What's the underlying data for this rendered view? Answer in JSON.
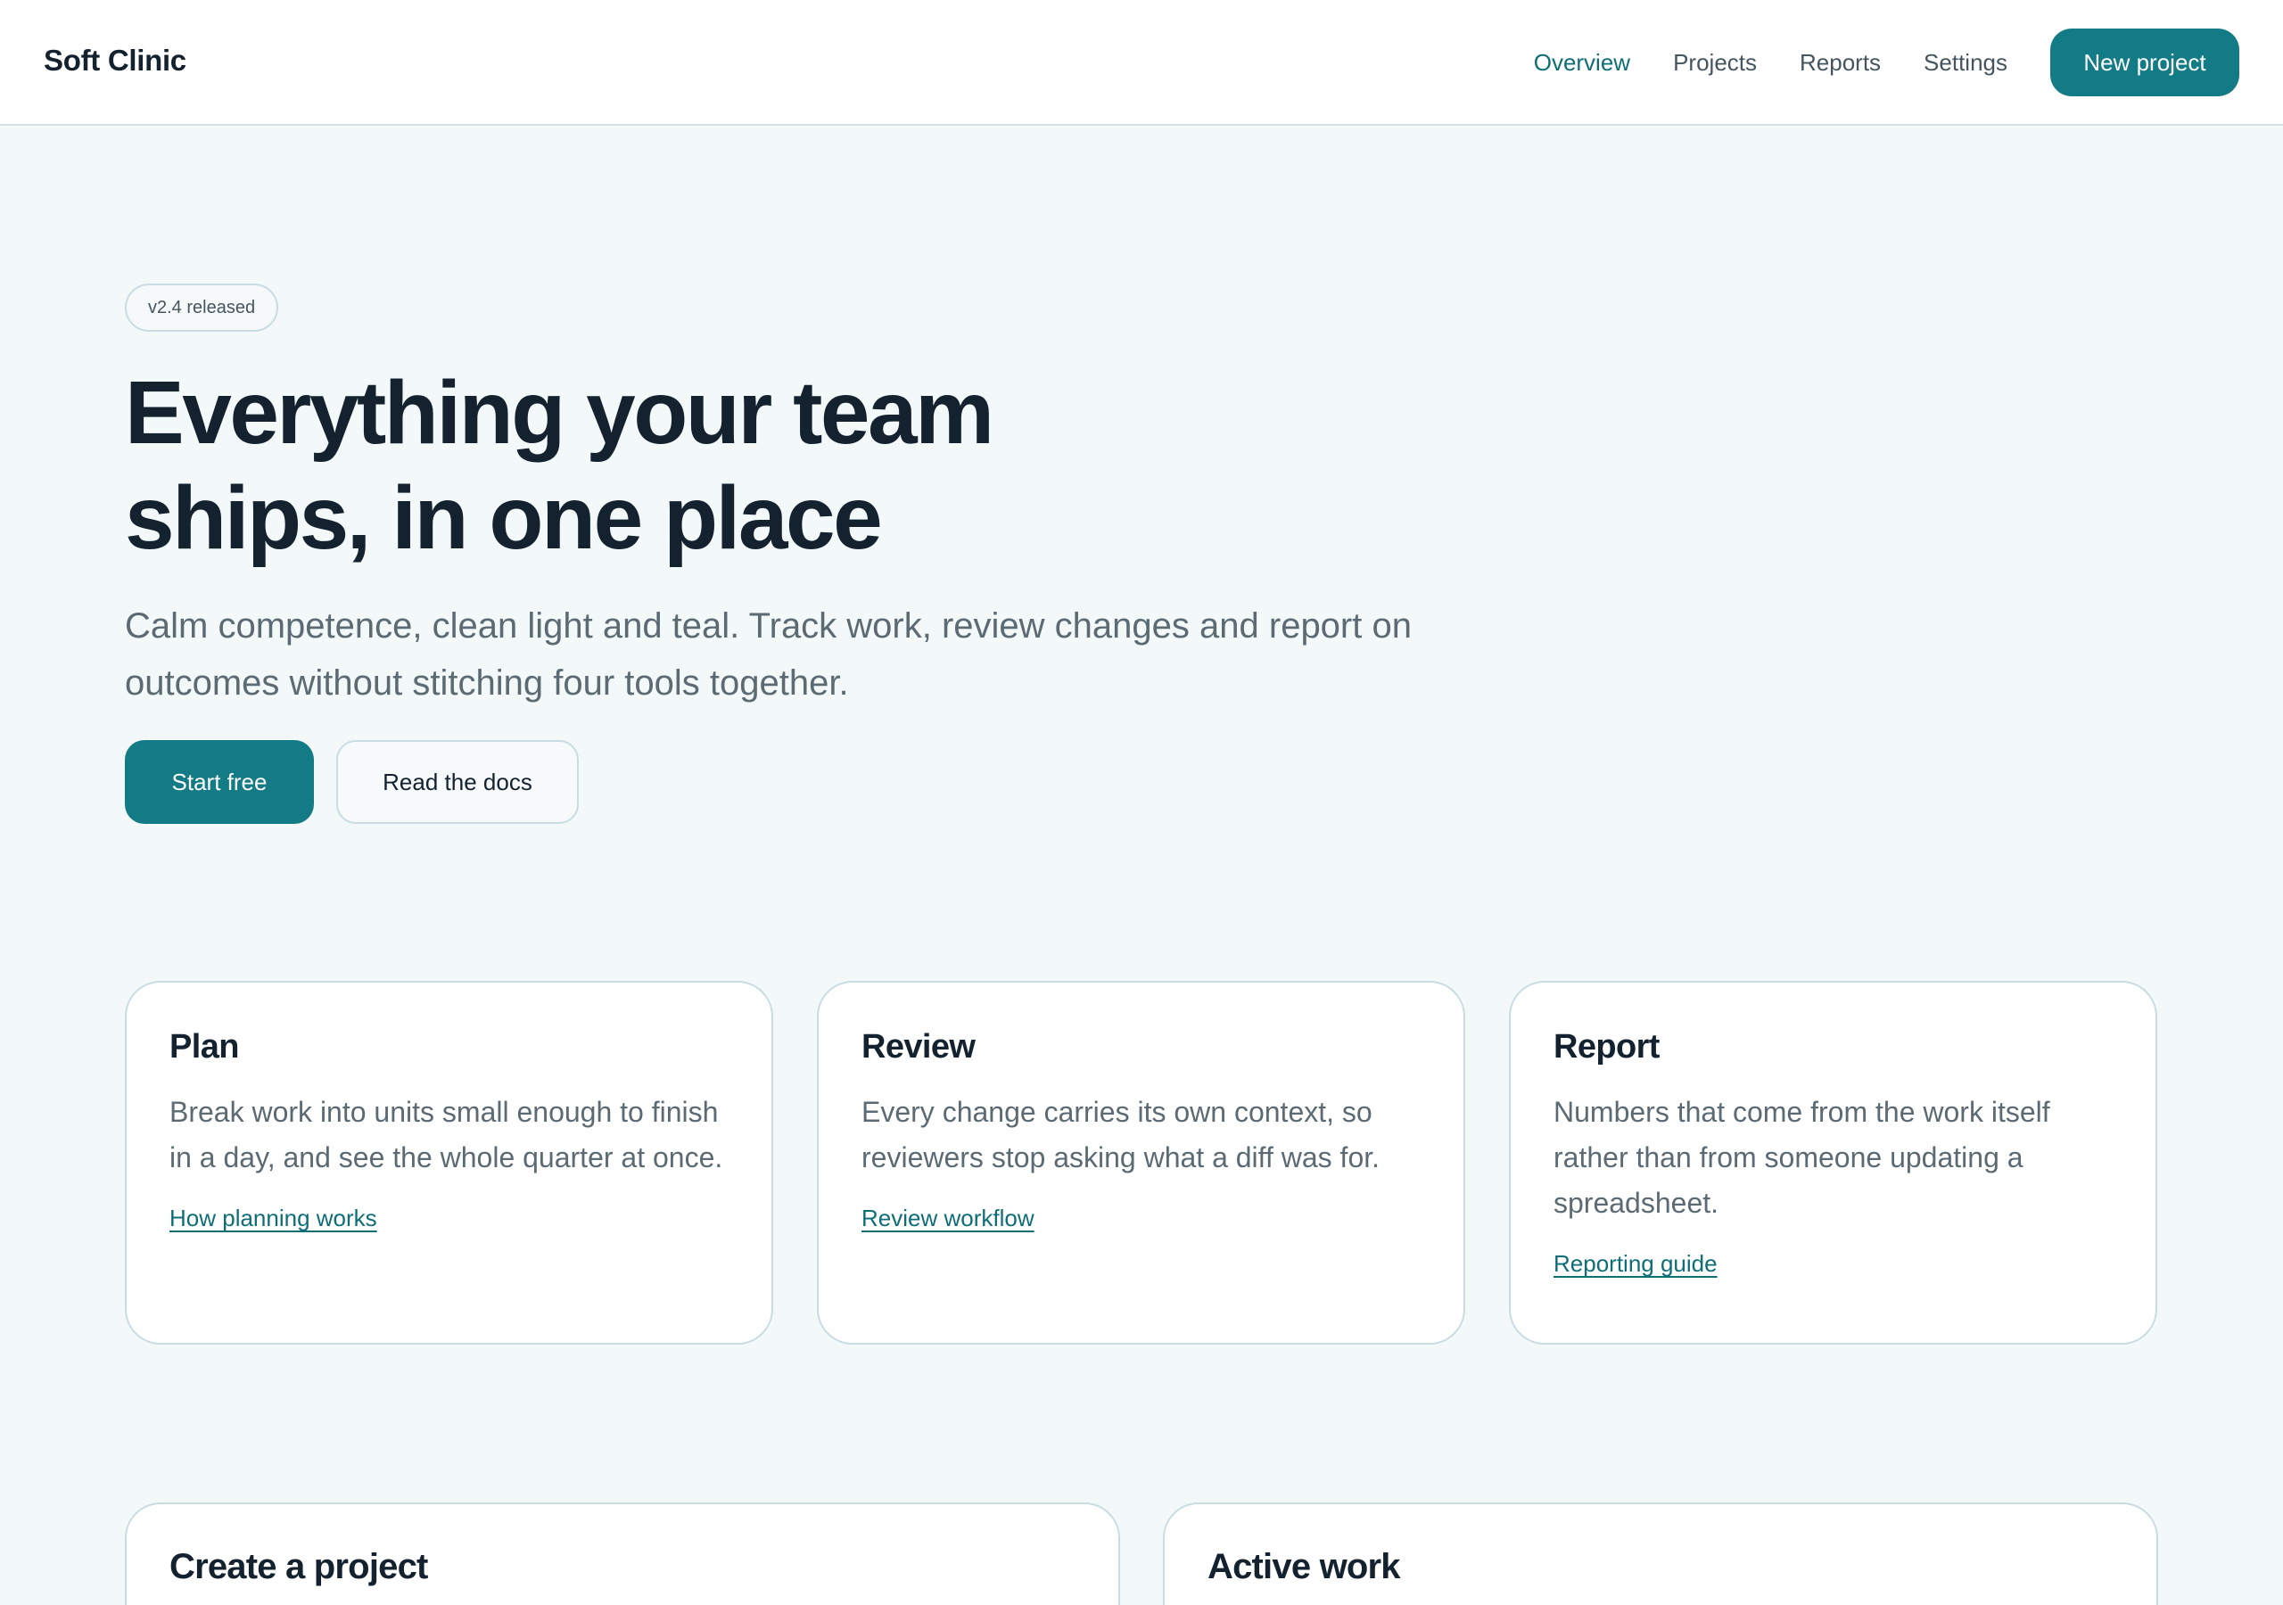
{
  "header": {
    "brand": "Soft Clinic",
    "nav": {
      "overview": "Overview",
      "projects": "Projects",
      "reports": "Reports",
      "settings": "Settings"
    },
    "cta_label": "New project"
  },
  "hero": {
    "badge": "v2.4 released",
    "title": "Everything your team ships, in one place",
    "subtitle": "Calm competence, clean light and teal. Track work, review changes and report on outcomes without stitching four tools together.",
    "primary_label": "Start free",
    "secondary_label": "Read the docs"
  },
  "features": [
    {
      "title": "Plan",
      "body": "Break work into units small enough to finish in a day, and see the whole quarter at once.",
      "link": "How planning works"
    },
    {
      "title": "Review",
      "body": "Every change carries its own context, so reviewers stop asking what a diff was for.",
      "link": "Review workflow"
    },
    {
      "title": "Report",
      "body": "Numbers that come from the work itself rather than from someone updating a spreadsheet.",
      "link": "Reporting guide"
    }
  ],
  "panels": {
    "create_title": "Create a project",
    "active_title": "Active work"
  },
  "colors": {
    "accent": "#137b85",
    "background": "#f3f8f9",
    "text": "#13222e",
    "muted": "#5b6a73"
  }
}
